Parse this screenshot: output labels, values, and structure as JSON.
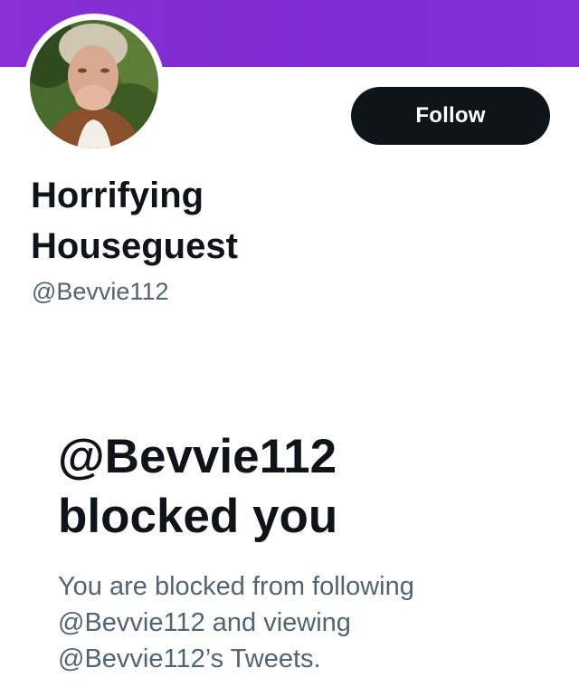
{
  "profile": {
    "display_name_line1": "Horrifying",
    "display_name_line2": "Houseguest",
    "handle": "@Bevvie112",
    "avatar_icon": "profile-photo",
    "follow_label": "Follow"
  },
  "blocked": {
    "title_line1": "@Bevvie112",
    "title_line2": "blocked you",
    "desc_line1": "You are blocked from following",
    "desc_line2": "@Bevvie112 and viewing",
    "desc_line3": "@Bevvie112’s Tweets."
  },
  "colors": {
    "banner": "#8a2fd6",
    "button_bg": "#0f1419",
    "text_primary": "#0f1419",
    "text_secondary": "#536471"
  }
}
